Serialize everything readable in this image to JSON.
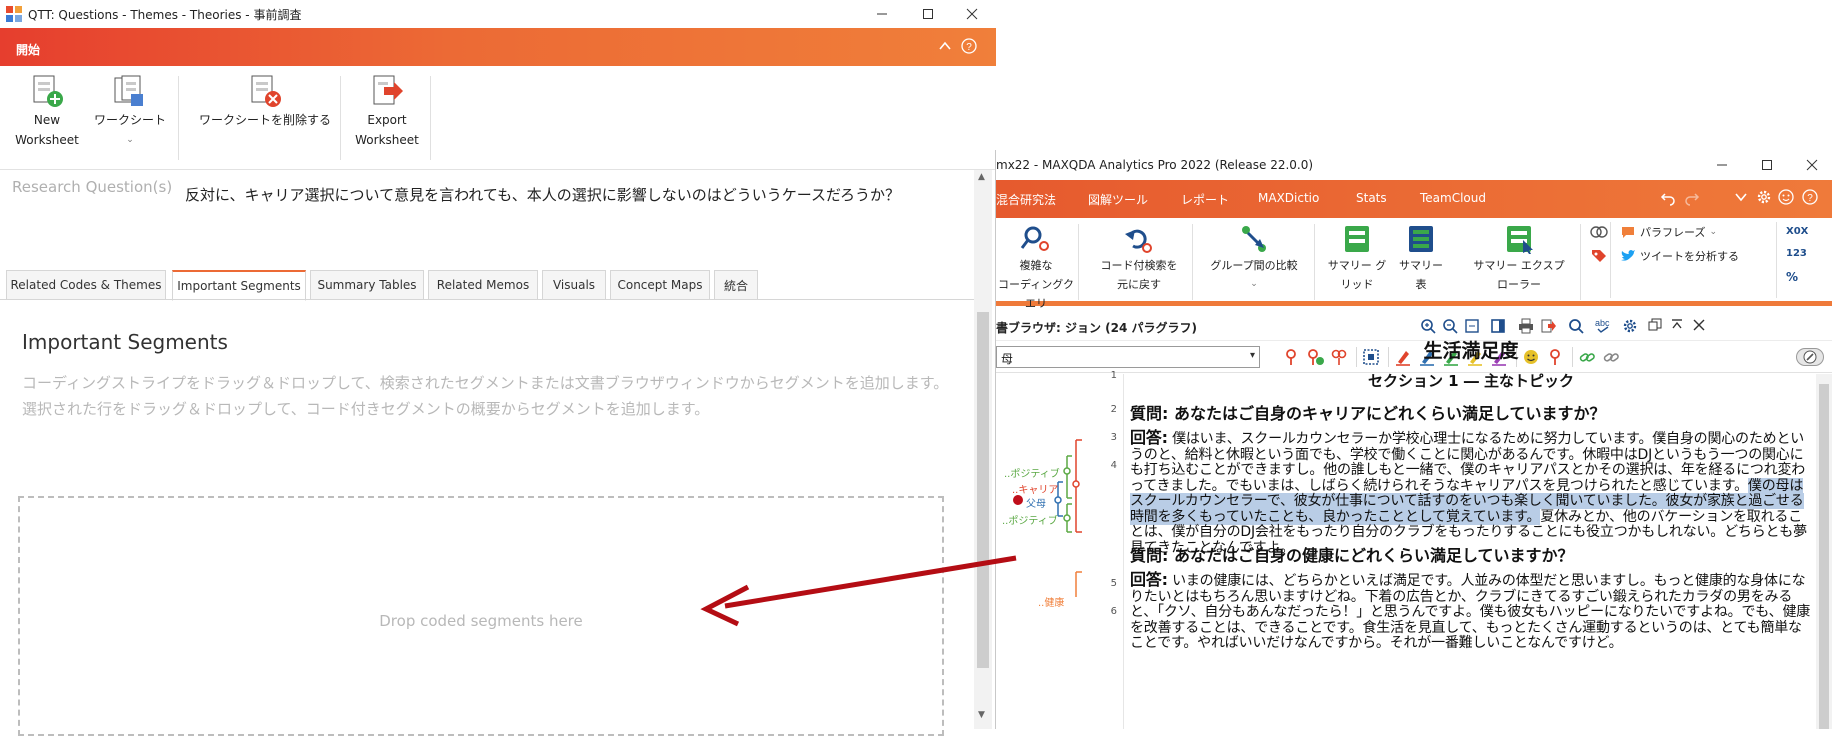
{
  "qtt": {
    "window_title": "QTT: Questions - Themes - Theories - 事前調査",
    "ribbon_tab": "開始",
    "ribbon": {
      "new_worksheet": [
        "New",
        "Worksheet"
      ],
      "worksheet": "ワークシート",
      "delete_worksheet": "ワークシートを削除する",
      "export_worksheet": [
        "Export",
        "Worksheet"
      ]
    },
    "research_question_label": "Research Question(s)",
    "research_question_text": "反対に、キャリア選択について意見を言われても、本人の選択に影響しないのはどういうケースだろうか？",
    "tabs": [
      "Related Codes & Themes",
      "Important Segments",
      "Summary Tables",
      "Related Memos",
      "Visuals",
      "Concept Maps",
      "統合"
    ],
    "active_tab_index": 1,
    "section_title": "Important Segments",
    "help_text": [
      "コーディングストライプをドラッグ＆ドロップして、検索されたセグメントまたは文書ブラウザウィンドウからセグメントを追加します。",
      "選択された行をドラッグ＆ドロップして、コード付きセグメントの概要からセグメントを追加します。"
    ],
    "dropzone_text": "Drop coded segments here",
    "accent_color": "#ec6a35"
  },
  "maxqda": {
    "window_title": "mx22 - MAXQDA Analytics Pro 2022 (Release 22.0.0)",
    "menu": [
      "混合研究法",
      "図解ツール",
      "レポート",
      "MAXDictio",
      "Stats",
      "TeamCloud"
    ],
    "ribbon": {
      "complex": [
        "複雑な",
        "コーディングクエリ"
      ],
      "restore": [
        "コード付検索を",
        "元に戻す"
      ],
      "group_compare": [
        "グループ間の比較"
      ],
      "summary_grid": [
        "サマリー グ",
        "リッド"
      ],
      "summary_table": [
        "サマリー",
        "表"
      ],
      "summary_explorer": [
        "サマリー エクスプ",
        "ローラー"
      ],
      "paraphrase": "パラフレーズ",
      "analyze_tweets": "ツイートを分析する",
      "right_labels": [
        "X0X",
        "123",
        "%"
      ]
    },
    "doc_browser_title": "書ブラウザ: ジョン  (24 パラグラフ)",
    "code_select_value": "母",
    "code_labels": {
      "positive1": "..ポジティブ",
      "career": "..キャリア",
      "parents": "父母",
      "positive2": "..ポジティブ",
      "health": "..健康"
    },
    "line_numbers": [
      "1",
      "2",
      "3",
      "4",
      "5",
      "6"
    ],
    "document": {
      "title": "生活満足度",
      "section": "セクション 1 ― 主なトピック",
      "q1": "質問: あなたはご自身のキャリアにどれくらい満足していますか？",
      "a1_label": "回答:",
      "a1_pre": " 僕はいま、スクールカウンセラーか学校心理士になるために努力しています。僕自身の関心のためというのと、給料と休暇という面でも、学校で働くことに関心があるんです。休暇中はDJというもう一つの関心にも打ち込むことができますし。他の誰しもと一緒で、僕のキャリアパスとかその選択は、年を経るにつれ変わってきました。でもいまは、しばらく続けられそうなキャリアパスを見つけられたと感じています。",
      "a1_highlight": "僕の母はスクールカウンセラーで、彼女が仕事について話すのをいつも楽しく聞いていました。彼女が家族と過ごせる時間を多くもっていたことも、良かったこととして覚えています。",
      "a1_post": "夏休みとか、他のバケーションを取れることは、僕が自分のDJ会社をもったり自分のクラブをもったりすることにも役立つかもしれない。どちらとも夢見てきたことなんですよ。",
      "q2": "質問: あなたはご自身の健康にどれくらい満足していますか？",
      "a2_label": "回答:",
      "a2_text": " いまの健康には、どちらかといえば満足です。人並みの体型だと思いますし。もっと健康的な身体になりたいとはもちろん思いますけどね。下着の広告とか、クラブにきてるすごい鍛えられたカラダの男をみると、「クソ、自分もあんなだったら！」と思うんですよ。僕も彼女もハッピーになりたいですよね。でも、健康を改善することは、できることです。食生活を見直して、もっとたくさん運動するというのは、とても簡単なことです。やればいいだけなんですから。それが一番難しいことなんですけど。"
    },
    "accent_color": "#ef7a3a",
    "highlight_color": "#b9cde6"
  }
}
